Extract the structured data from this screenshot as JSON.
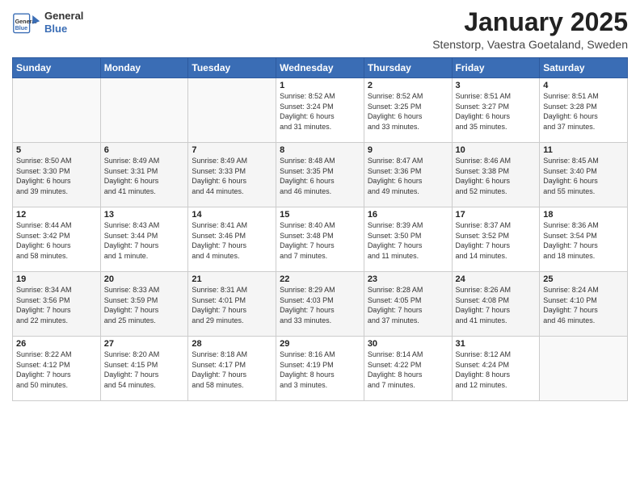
{
  "logo": {
    "line1": "General",
    "line2": "Blue"
  },
  "title": "January 2025",
  "subtitle": "Stenstorp, Vaestra Goetaland, Sweden",
  "days_of_week": [
    "Sunday",
    "Monday",
    "Tuesday",
    "Wednesday",
    "Thursday",
    "Friday",
    "Saturday"
  ],
  "weeks": [
    [
      {
        "day": "",
        "info": ""
      },
      {
        "day": "",
        "info": ""
      },
      {
        "day": "",
        "info": ""
      },
      {
        "day": "1",
        "info": "Sunrise: 8:52 AM\nSunset: 3:24 PM\nDaylight: 6 hours\nand 31 minutes."
      },
      {
        "day": "2",
        "info": "Sunrise: 8:52 AM\nSunset: 3:25 PM\nDaylight: 6 hours\nand 33 minutes."
      },
      {
        "day": "3",
        "info": "Sunrise: 8:51 AM\nSunset: 3:27 PM\nDaylight: 6 hours\nand 35 minutes."
      },
      {
        "day": "4",
        "info": "Sunrise: 8:51 AM\nSunset: 3:28 PM\nDaylight: 6 hours\nand 37 minutes."
      }
    ],
    [
      {
        "day": "5",
        "info": "Sunrise: 8:50 AM\nSunset: 3:30 PM\nDaylight: 6 hours\nand 39 minutes."
      },
      {
        "day": "6",
        "info": "Sunrise: 8:49 AM\nSunset: 3:31 PM\nDaylight: 6 hours\nand 41 minutes."
      },
      {
        "day": "7",
        "info": "Sunrise: 8:49 AM\nSunset: 3:33 PM\nDaylight: 6 hours\nand 44 minutes."
      },
      {
        "day": "8",
        "info": "Sunrise: 8:48 AM\nSunset: 3:35 PM\nDaylight: 6 hours\nand 46 minutes."
      },
      {
        "day": "9",
        "info": "Sunrise: 8:47 AM\nSunset: 3:36 PM\nDaylight: 6 hours\nand 49 minutes."
      },
      {
        "day": "10",
        "info": "Sunrise: 8:46 AM\nSunset: 3:38 PM\nDaylight: 6 hours\nand 52 minutes."
      },
      {
        "day": "11",
        "info": "Sunrise: 8:45 AM\nSunset: 3:40 PM\nDaylight: 6 hours\nand 55 minutes."
      }
    ],
    [
      {
        "day": "12",
        "info": "Sunrise: 8:44 AM\nSunset: 3:42 PM\nDaylight: 6 hours\nand 58 minutes."
      },
      {
        "day": "13",
        "info": "Sunrise: 8:43 AM\nSunset: 3:44 PM\nDaylight: 7 hours\nand 1 minute."
      },
      {
        "day": "14",
        "info": "Sunrise: 8:41 AM\nSunset: 3:46 PM\nDaylight: 7 hours\nand 4 minutes."
      },
      {
        "day": "15",
        "info": "Sunrise: 8:40 AM\nSunset: 3:48 PM\nDaylight: 7 hours\nand 7 minutes."
      },
      {
        "day": "16",
        "info": "Sunrise: 8:39 AM\nSunset: 3:50 PM\nDaylight: 7 hours\nand 11 minutes."
      },
      {
        "day": "17",
        "info": "Sunrise: 8:37 AM\nSunset: 3:52 PM\nDaylight: 7 hours\nand 14 minutes."
      },
      {
        "day": "18",
        "info": "Sunrise: 8:36 AM\nSunset: 3:54 PM\nDaylight: 7 hours\nand 18 minutes."
      }
    ],
    [
      {
        "day": "19",
        "info": "Sunrise: 8:34 AM\nSunset: 3:56 PM\nDaylight: 7 hours\nand 22 minutes."
      },
      {
        "day": "20",
        "info": "Sunrise: 8:33 AM\nSunset: 3:59 PM\nDaylight: 7 hours\nand 25 minutes."
      },
      {
        "day": "21",
        "info": "Sunrise: 8:31 AM\nSunset: 4:01 PM\nDaylight: 7 hours\nand 29 minutes."
      },
      {
        "day": "22",
        "info": "Sunrise: 8:29 AM\nSunset: 4:03 PM\nDaylight: 7 hours\nand 33 minutes."
      },
      {
        "day": "23",
        "info": "Sunrise: 8:28 AM\nSunset: 4:05 PM\nDaylight: 7 hours\nand 37 minutes."
      },
      {
        "day": "24",
        "info": "Sunrise: 8:26 AM\nSunset: 4:08 PM\nDaylight: 7 hours\nand 41 minutes."
      },
      {
        "day": "25",
        "info": "Sunrise: 8:24 AM\nSunset: 4:10 PM\nDaylight: 7 hours\nand 46 minutes."
      }
    ],
    [
      {
        "day": "26",
        "info": "Sunrise: 8:22 AM\nSunset: 4:12 PM\nDaylight: 7 hours\nand 50 minutes."
      },
      {
        "day": "27",
        "info": "Sunrise: 8:20 AM\nSunset: 4:15 PM\nDaylight: 7 hours\nand 54 minutes."
      },
      {
        "day": "28",
        "info": "Sunrise: 8:18 AM\nSunset: 4:17 PM\nDaylight: 7 hours\nand 58 minutes."
      },
      {
        "day": "29",
        "info": "Sunrise: 8:16 AM\nSunset: 4:19 PM\nDaylight: 8 hours\nand 3 minutes."
      },
      {
        "day": "30",
        "info": "Sunrise: 8:14 AM\nSunset: 4:22 PM\nDaylight: 8 hours\nand 7 minutes."
      },
      {
        "day": "31",
        "info": "Sunrise: 8:12 AM\nSunset: 4:24 PM\nDaylight: 8 hours\nand 12 minutes."
      },
      {
        "day": "",
        "info": ""
      }
    ]
  ]
}
